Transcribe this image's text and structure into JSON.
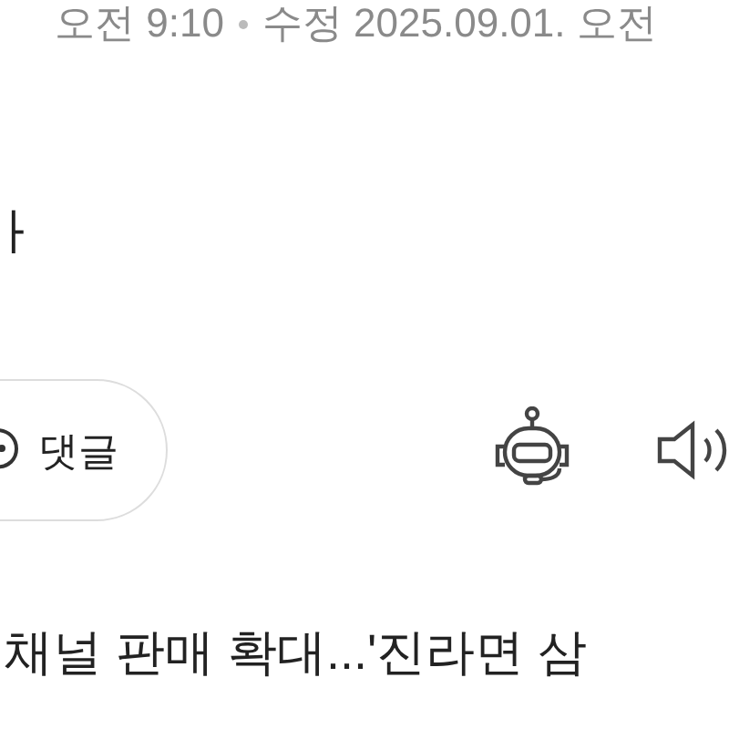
{
  "meta": {
    "published": "오전 9:10",
    "modified": "수정 2025.09.01. 오전"
  },
  "title_fragment": "ㅏ",
  "actions": {
    "comment_button": "댓글"
  },
  "next_headline": "채널 판매 확대...'진라면 삼"
}
